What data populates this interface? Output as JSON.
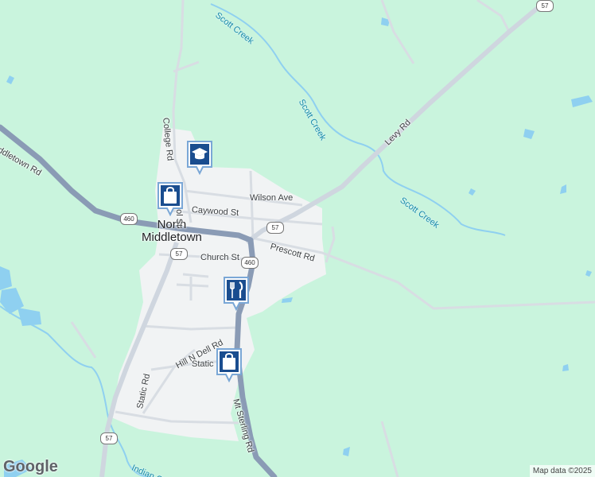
{
  "map": {
    "town": "North Middletown",
    "town_lines": [
      "North",
      "Middletown"
    ],
    "colors": {
      "land": "#c9f4dd",
      "urban": "#f1f3f4",
      "water": "#8fd0f0",
      "highway": "#8a9bb5",
      "road": "#d8dde3",
      "accent": "#1a4d8f"
    },
    "streets": {
      "college_rd": "College Rd",
      "school_st": "School St",
      "wilson_ave": "Wilson Ave",
      "caywood_st": "Caywood St",
      "prescott_rd": "Prescott Rd",
      "church_st": "Church St",
      "levy_rd": "Levy Rd",
      "middletown_rd": "ddletown Rd",
      "hill_n_dell_rd": "Hill N Dell Rd",
      "static_rd_h": "Static",
      "static_rd_v": "Static Rd",
      "mt_sterling_rd": "Mt Sterling Rd",
      "indian_creek": "Indian C"
    },
    "water_labels": {
      "scott_creek_1": "Scott Creek",
      "scott_creek_2": "Scott Creek",
      "scott_creek_3": "Scott Creek"
    },
    "shields": {
      "us460_a": "460",
      "us460_b": "460",
      "ky57_a": "57",
      "ky57_b": "57",
      "ky57_c": "57",
      "ky57_d": "57"
    },
    "pins": [
      {
        "name": "school-pin",
        "icon": "graduation-cap-icon"
      },
      {
        "name": "shopping-pin-north",
        "icon": "shopping-bag-icon"
      },
      {
        "name": "restaurant-pin",
        "icon": "fork-knife-icon"
      },
      {
        "name": "shopping-pin-south",
        "icon": "shopping-bag-icon"
      }
    ],
    "logo": "Google",
    "attribution": "Map data ©2025"
  }
}
